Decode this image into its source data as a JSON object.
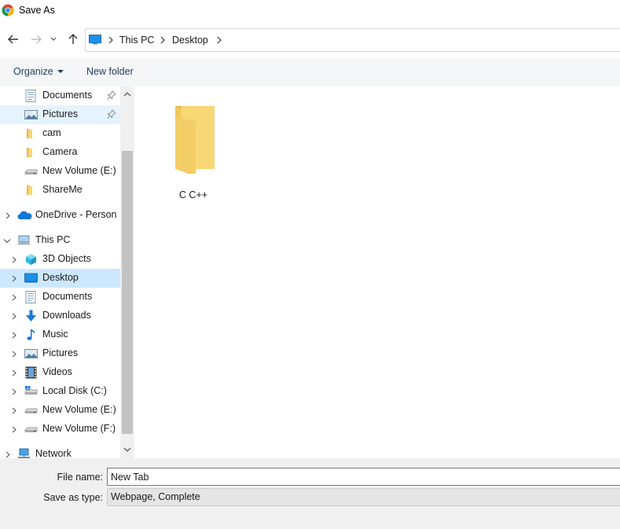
{
  "window": {
    "title": "Save As"
  },
  "address": {
    "segments": [
      "This PC",
      "Desktop"
    ]
  },
  "toolbar": {
    "organize_label": "Organize",
    "new_folder_label": "New folder"
  },
  "nav_pane": {
    "quick_access": [
      {
        "label": "Documents",
        "icon": "documents-icon",
        "pinned": true
      },
      {
        "label": "Pictures",
        "icon": "pictures-icon",
        "pinned": true,
        "hover": true
      },
      {
        "label": "cam",
        "icon": "folder-icon"
      },
      {
        "label": "Camera",
        "icon": "folder-icon"
      },
      {
        "label": "New Volume (E:)",
        "icon": "drive-icon"
      },
      {
        "label": "ShareMe",
        "icon": "folder-icon"
      }
    ],
    "onedrive": {
      "label": "OneDrive - Person"
    },
    "this_pc": {
      "label": "This PC",
      "children": [
        {
          "label": "3D Objects",
          "icon": "3d-objects-icon"
        },
        {
          "label": "Desktop",
          "icon": "desktop-icon",
          "selected": true
        },
        {
          "label": "Documents",
          "icon": "documents-icon"
        },
        {
          "label": "Downloads",
          "icon": "downloads-icon"
        },
        {
          "label": "Music",
          "icon": "music-icon"
        },
        {
          "label": "Pictures",
          "icon": "pictures-icon"
        },
        {
          "label": "Videos",
          "icon": "videos-icon"
        },
        {
          "label": "Local Disk (C:)",
          "icon": "local-disk-icon"
        },
        {
          "label": "New Volume (E:)",
          "icon": "drive-icon"
        },
        {
          "label": "New Volume (F:)",
          "icon": "drive-icon"
        }
      ]
    },
    "network": {
      "label": "Network"
    }
  },
  "content": {
    "items": [
      {
        "name": "C C++",
        "type": "folder"
      }
    ]
  },
  "form": {
    "file_name_label": "File name:",
    "file_name_value": "New Tab",
    "save_type_label": "Save as type:",
    "save_type_value": "Webpage, Complete"
  },
  "colors": {
    "selected_bg": "#cce8ff",
    "hover_bg": "#e5f3ff",
    "folder_yellow": "#f8d775",
    "link_blue": "#1e3b5a"
  }
}
